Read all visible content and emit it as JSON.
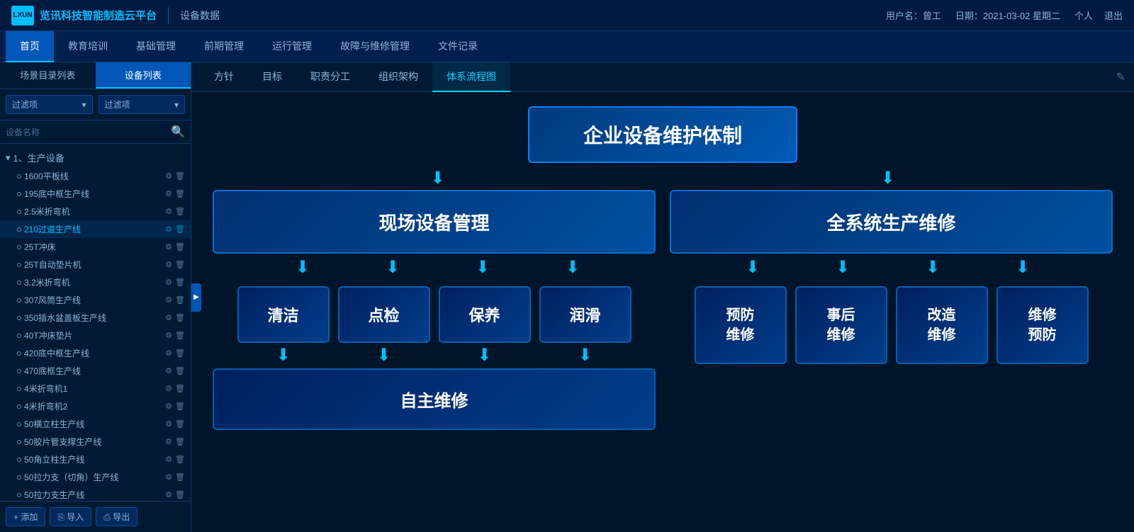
{
  "header": {
    "logo_text": "览讯科技智能制造云平台",
    "logo_abbr": "LXUN",
    "module": "设备数据",
    "user_label": "用户名：曾工",
    "date_label": "日期：2021-03-02 星期二",
    "personal": "个人",
    "logout": "退出"
  },
  "nav": {
    "tabs": [
      {
        "label": "首页",
        "active": false
      },
      {
        "label": "教育培训",
        "active": false
      },
      {
        "label": "基础管理",
        "active": false
      },
      {
        "label": "前期管理",
        "active": false
      },
      {
        "label": "运行管理",
        "active": false
      },
      {
        "label": "故障与维修管理",
        "active": false
      },
      {
        "label": "文件记录",
        "active": false
      }
    ]
  },
  "sidebar": {
    "filter1_label": "过滤项",
    "filter2_label": "过滤项",
    "search_placeholder": "设备名称",
    "group_label": "1、生产设备",
    "items": [
      {
        "name": "1600平板线"
      },
      {
        "name": "195底中框生产线"
      },
      {
        "name": "2.5米折弯机"
      },
      {
        "name": "210过道生产线"
      },
      {
        "name": "25T冲床"
      },
      {
        "name": "25T自动垫片机"
      },
      {
        "name": "3.2米折弯机"
      },
      {
        "name": "307风筒生产线"
      },
      {
        "name": "350插水盆盖板生产线"
      },
      {
        "name": "40T冲床垫片"
      },
      {
        "name": "420底中框生产线"
      },
      {
        "name": "470底框生产线"
      },
      {
        "name": "4米折弯机1"
      },
      {
        "name": "4米折弯机2"
      },
      {
        "name": "50横立柱生产线"
      },
      {
        "name": "50胶片管支撑生产线"
      },
      {
        "name": "50角立柱生产线"
      },
      {
        "name": "50拉力支（切角）生产线"
      },
      {
        "name": "50拉力支生产线"
      }
    ],
    "add_btn": "+ 添加",
    "import_btn": "导入",
    "export_btn": "导出"
  },
  "sub_tabs": {
    "tabs": [
      {
        "label": "方针",
        "active": false
      },
      {
        "label": "目标",
        "active": false
      },
      {
        "label": "职责分工",
        "active": false
      },
      {
        "label": "组织架构",
        "active": false
      },
      {
        "label": "体系流程图",
        "active": true
      }
    ]
  },
  "flow": {
    "top_box": "企业设备维护体制",
    "mid_left": "现场设备管理",
    "mid_right": "全系统生产维修",
    "sub_boxes_left": [
      "清洁",
      "点检",
      "保养",
      "润滑"
    ],
    "bottom_box": "自主维修",
    "sub_boxes_right": [
      "预防\n维修",
      "事后\n维修",
      "改造\n维修",
      "维修\n预防"
    ]
  }
}
